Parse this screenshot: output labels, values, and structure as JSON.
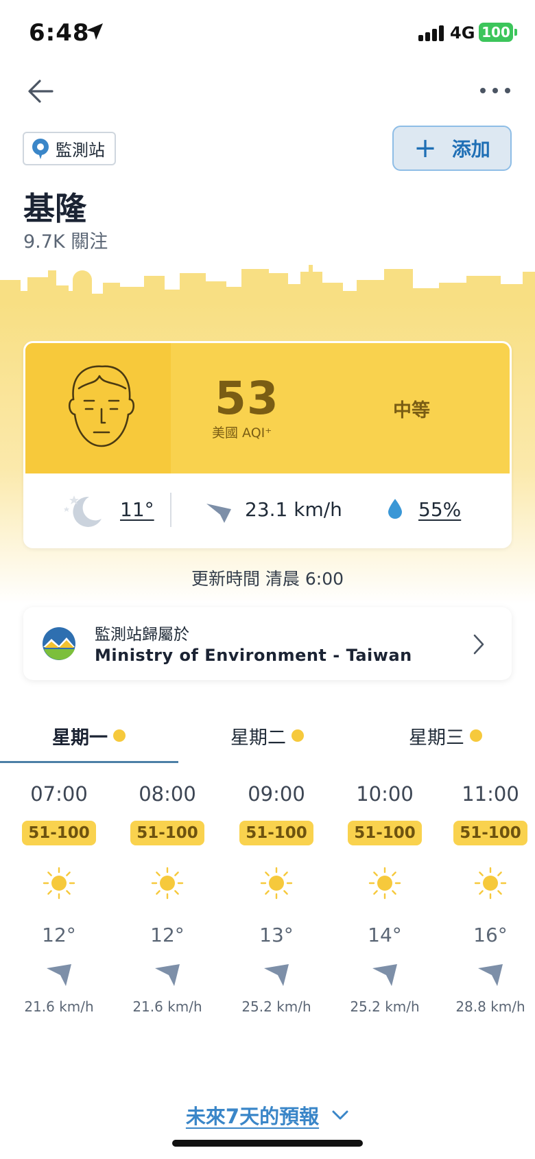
{
  "status_bar": {
    "time": "6:48",
    "network": "4G",
    "battery": "100"
  },
  "header": {
    "station_chip": "監測站",
    "add_button": "添加",
    "city": "基隆",
    "followers": "9.7K 關注"
  },
  "aqi": {
    "value": "53",
    "scale_label": "美國 AQI⁺",
    "level": "中等",
    "temperature": "11°",
    "wind": "23.1 km/h",
    "humidity": "55%"
  },
  "updated": "更新時間 清晨 6:00",
  "ministry": {
    "label": "監測站歸屬於",
    "name": "Ministry of Environment - Taiwan"
  },
  "days": [
    {
      "label": "星期一"
    },
    {
      "label": "星期二"
    },
    {
      "label": "星期三"
    }
  ],
  "hourly": [
    {
      "time": "07:00",
      "aqi": "51-100",
      "temp": "12°",
      "wind": "21.6 km/h"
    },
    {
      "time": "08:00",
      "aqi": "51-100",
      "temp": "12°",
      "wind": "21.6 km/h"
    },
    {
      "time": "09:00",
      "aqi": "51-100",
      "temp": "13°",
      "wind": "25.2 km/h"
    },
    {
      "time": "10:00",
      "aqi": "51-100",
      "temp": "14°",
      "wind": "25.2 km/h"
    },
    {
      "time": "11:00",
      "aqi": "51-100",
      "temp": "16°",
      "wind": "28.8 km/h"
    }
  ],
  "forecast_link": "未來7天的預報",
  "colors": {
    "aqi_yellow": "#f9d24e",
    "accent_blue": "#3a86c8"
  }
}
